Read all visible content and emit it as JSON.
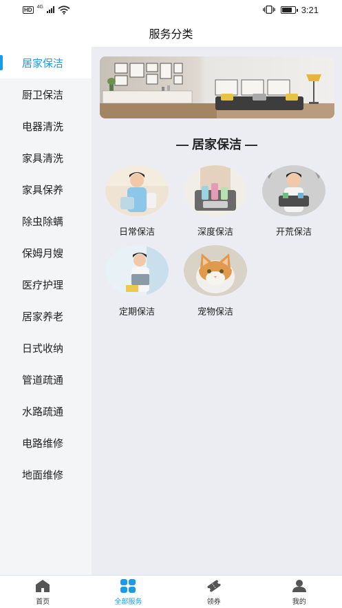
{
  "status_bar": {
    "hd": "HD",
    "network": "4G",
    "time": "3:21",
    "battery_level": 0.8
  },
  "header": {
    "title": "服务分类"
  },
  "sidebar": {
    "items": [
      {
        "label": "居家保洁",
        "active": true
      },
      {
        "label": "厨卫保洁"
      },
      {
        "label": "电器清洗"
      },
      {
        "label": "家具清洗"
      },
      {
        "label": "家具保养"
      },
      {
        "label": "除虫除螨"
      },
      {
        "label": "保姆月嫂"
      },
      {
        "label": "医疗护理"
      },
      {
        "label": "居家养老"
      },
      {
        "label": "日式收纳"
      },
      {
        "label": "管道疏通"
      },
      {
        "label": "水路疏通"
      },
      {
        "label": "电路维修"
      },
      {
        "label": "地面维修"
      }
    ]
  },
  "content": {
    "section_title": "— 居家保洁 —",
    "categories": [
      {
        "label": "日常保洁",
        "icon": "cleaner-photo-icon"
      },
      {
        "label": "深度保洁",
        "icon": "cleaning-supplies-photo-icon"
      },
      {
        "label": "开荒保洁",
        "icon": "cleaner-with-basket-photo-icon"
      },
      {
        "label": "定期保洁",
        "icon": "cleaner-with-box-photo-icon"
      },
      {
        "label": "宠物保洁",
        "icon": "cat-photo-icon"
      }
    ]
  },
  "tabbar": {
    "items": [
      {
        "label": "首页",
        "icon": "home-icon"
      },
      {
        "label": "全部服务",
        "icon": "grid-icon",
        "active": true
      },
      {
        "label": "领券",
        "icon": "coupon-icon"
      },
      {
        "label": "我的",
        "icon": "user-icon"
      }
    ]
  },
  "colors": {
    "accent": "#1a9be8",
    "sidebar_bg": "#f4f5f7",
    "content_bg": "#ecedf2"
  }
}
